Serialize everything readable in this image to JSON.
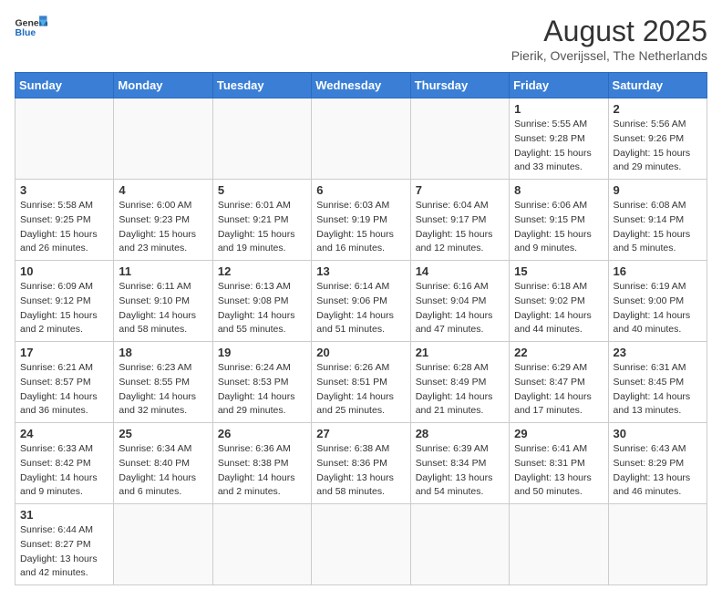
{
  "header": {
    "logo_general": "General",
    "logo_blue": "Blue",
    "month_title": "August 2025",
    "subtitle": "Pierik, Overijssel, The Netherlands"
  },
  "days_of_week": [
    "Sunday",
    "Monday",
    "Tuesday",
    "Wednesday",
    "Thursday",
    "Friday",
    "Saturday"
  ],
  "weeks": [
    [
      {
        "day": "",
        "info": ""
      },
      {
        "day": "",
        "info": ""
      },
      {
        "day": "",
        "info": ""
      },
      {
        "day": "",
        "info": ""
      },
      {
        "day": "",
        "info": ""
      },
      {
        "day": "1",
        "info": "Sunrise: 5:55 AM\nSunset: 9:28 PM\nDaylight: 15 hours and 33 minutes."
      },
      {
        "day": "2",
        "info": "Sunrise: 5:56 AM\nSunset: 9:26 PM\nDaylight: 15 hours and 29 minutes."
      }
    ],
    [
      {
        "day": "3",
        "info": "Sunrise: 5:58 AM\nSunset: 9:25 PM\nDaylight: 15 hours and 26 minutes."
      },
      {
        "day": "4",
        "info": "Sunrise: 6:00 AM\nSunset: 9:23 PM\nDaylight: 15 hours and 23 minutes."
      },
      {
        "day": "5",
        "info": "Sunrise: 6:01 AM\nSunset: 9:21 PM\nDaylight: 15 hours and 19 minutes."
      },
      {
        "day": "6",
        "info": "Sunrise: 6:03 AM\nSunset: 9:19 PM\nDaylight: 15 hours and 16 minutes."
      },
      {
        "day": "7",
        "info": "Sunrise: 6:04 AM\nSunset: 9:17 PM\nDaylight: 15 hours and 12 minutes."
      },
      {
        "day": "8",
        "info": "Sunrise: 6:06 AM\nSunset: 9:15 PM\nDaylight: 15 hours and 9 minutes."
      },
      {
        "day": "9",
        "info": "Sunrise: 6:08 AM\nSunset: 9:14 PM\nDaylight: 15 hours and 5 minutes."
      }
    ],
    [
      {
        "day": "10",
        "info": "Sunrise: 6:09 AM\nSunset: 9:12 PM\nDaylight: 15 hours and 2 minutes."
      },
      {
        "day": "11",
        "info": "Sunrise: 6:11 AM\nSunset: 9:10 PM\nDaylight: 14 hours and 58 minutes."
      },
      {
        "day": "12",
        "info": "Sunrise: 6:13 AM\nSunset: 9:08 PM\nDaylight: 14 hours and 55 minutes."
      },
      {
        "day": "13",
        "info": "Sunrise: 6:14 AM\nSunset: 9:06 PM\nDaylight: 14 hours and 51 minutes."
      },
      {
        "day": "14",
        "info": "Sunrise: 6:16 AM\nSunset: 9:04 PM\nDaylight: 14 hours and 47 minutes."
      },
      {
        "day": "15",
        "info": "Sunrise: 6:18 AM\nSunset: 9:02 PM\nDaylight: 14 hours and 44 minutes."
      },
      {
        "day": "16",
        "info": "Sunrise: 6:19 AM\nSunset: 9:00 PM\nDaylight: 14 hours and 40 minutes."
      }
    ],
    [
      {
        "day": "17",
        "info": "Sunrise: 6:21 AM\nSunset: 8:57 PM\nDaylight: 14 hours and 36 minutes."
      },
      {
        "day": "18",
        "info": "Sunrise: 6:23 AM\nSunset: 8:55 PM\nDaylight: 14 hours and 32 minutes."
      },
      {
        "day": "19",
        "info": "Sunrise: 6:24 AM\nSunset: 8:53 PM\nDaylight: 14 hours and 29 minutes."
      },
      {
        "day": "20",
        "info": "Sunrise: 6:26 AM\nSunset: 8:51 PM\nDaylight: 14 hours and 25 minutes."
      },
      {
        "day": "21",
        "info": "Sunrise: 6:28 AM\nSunset: 8:49 PM\nDaylight: 14 hours and 21 minutes."
      },
      {
        "day": "22",
        "info": "Sunrise: 6:29 AM\nSunset: 8:47 PM\nDaylight: 14 hours and 17 minutes."
      },
      {
        "day": "23",
        "info": "Sunrise: 6:31 AM\nSunset: 8:45 PM\nDaylight: 14 hours and 13 minutes."
      }
    ],
    [
      {
        "day": "24",
        "info": "Sunrise: 6:33 AM\nSunset: 8:42 PM\nDaylight: 14 hours and 9 minutes."
      },
      {
        "day": "25",
        "info": "Sunrise: 6:34 AM\nSunset: 8:40 PM\nDaylight: 14 hours and 6 minutes."
      },
      {
        "day": "26",
        "info": "Sunrise: 6:36 AM\nSunset: 8:38 PM\nDaylight: 14 hours and 2 minutes."
      },
      {
        "day": "27",
        "info": "Sunrise: 6:38 AM\nSunset: 8:36 PM\nDaylight: 13 hours and 58 minutes."
      },
      {
        "day": "28",
        "info": "Sunrise: 6:39 AM\nSunset: 8:34 PM\nDaylight: 13 hours and 54 minutes."
      },
      {
        "day": "29",
        "info": "Sunrise: 6:41 AM\nSunset: 8:31 PM\nDaylight: 13 hours and 50 minutes."
      },
      {
        "day": "30",
        "info": "Sunrise: 6:43 AM\nSunset: 8:29 PM\nDaylight: 13 hours and 46 minutes."
      }
    ],
    [
      {
        "day": "31",
        "info": "Sunrise: 6:44 AM\nSunset: 8:27 PM\nDaylight: 13 hours and 42 minutes."
      },
      {
        "day": "",
        "info": ""
      },
      {
        "day": "",
        "info": ""
      },
      {
        "day": "",
        "info": ""
      },
      {
        "day": "",
        "info": ""
      },
      {
        "day": "",
        "info": ""
      },
      {
        "day": "",
        "info": ""
      }
    ]
  ]
}
